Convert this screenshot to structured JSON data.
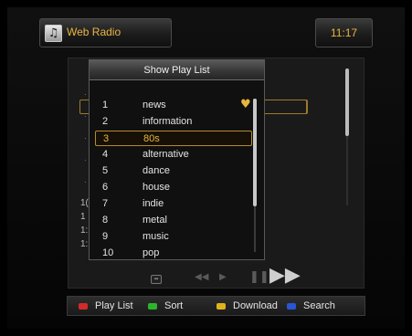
{
  "header": {
    "app_icon": "music-note-icon",
    "title": "Web Radio",
    "clock": "11:17"
  },
  "popup": {
    "title": "Show Play List",
    "items": [
      {
        "num": "1",
        "name": "news",
        "favorite": true
      },
      {
        "num": "2",
        "name": "information"
      },
      {
        "num": "3",
        "name": "80s",
        "selected": true
      },
      {
        "num": "4",
        "name": "alternative"
      },
      {
        "num": "5",
        "name": "dance"
      },
      {
        "num": "6",
        "name": "house"
      },
      {
        "num": "7",
        "name": "indie"
      },
      {
        "num": "8",
        "name": "metal"
      },
      {
        "num": "9",
        "name": "music"
      },
      {
        "num": "10",
        "name": "pop"
      }
    ]
  },
  "background_list": {
    "visible_numbers": [
      "1(",
      "1",
      "1:",
      "1:"
    ]
  },
  "footer": {
    "keys": [
      {
        "color": "#d42a2a",
        "label": "Play List"
      },
      {
        "color": "#2cb52c",
        "label": "Sort"
      },
      {
        "color": "#e0b21c",
        "label": "Download"
      },
      {
        "color": "#2a55d4",
        "label": "Search"
      }
    ]
  },
  "colors": {
    "accent": "#e8b640",
    "selection_border": "#b4892e"
  }
}
